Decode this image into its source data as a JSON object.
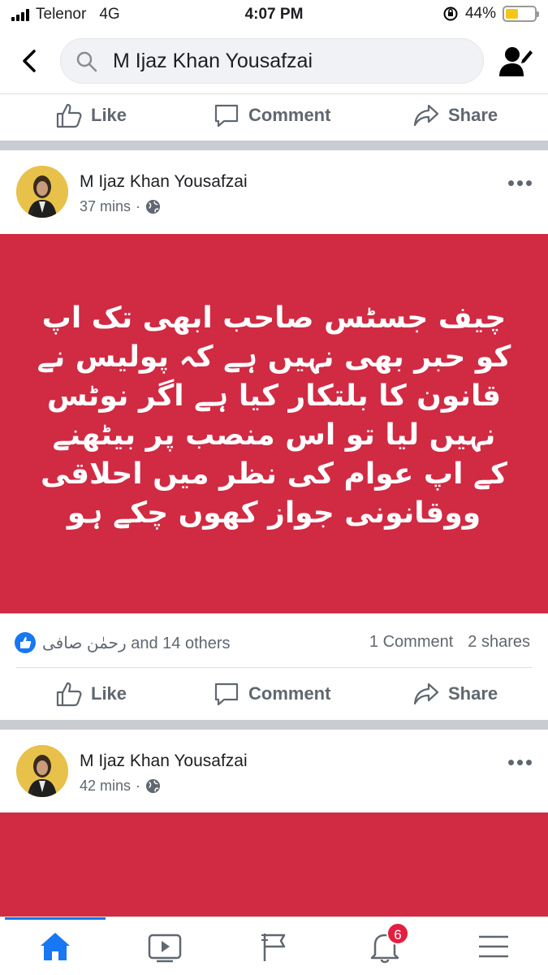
{
  "status_bar": {
    "carrier": "Telenor",
    "network": "4G",
    "time": "4:07 PM",
    "battery": "44%",
    "battery_level": 0.44
  },
  "search": {
    "value": "M Ijaz Khan Yousafzai"
  },
  "actions": {
    "like": "Like",
    "comment": "Comment",
    "share": "Share"
  },
  "posts": [
    {
      "author": "M Ijaz Khan Yousafzai",
      "time": "37 mins",
      "separator": "·",
      "text": "چیف جسٹس صاحب  ابھی تک اپ کو حبر بھی نہیں ہے کہ  پولیس نے قانون کا بلتکار کیا ہے اگر  نوٹس نہیں لیا تو  اس منصب  پر بیٹھنے کے اپ عوام کی نظر میں احلاقی ووقانونی جواز کھوں چکے ہو",
      "reaction_names": "رحمٰن صافی",
      "reaction_others": "and 14 others",
      "comments": "1 Comment",
      "shares": "2 shares"
    },
    {
      "author": "M Ijaz Khan Yousafzai",
      "time": "42 mins",
      "separator": "·"
    }
  ],
  "nav": {
    "notification_count": "6"
  },
  "colors": {
    "post_bg": "#d12a43",
    "accent": "#1877f2",
    "badge": "#e41e3f"
  },
  "icons": [
    "back-arrow-icon",
    "search-icon",
    "profile-edit-icon",
    "thumbs-up-icon",
    "comment-icon",
    "share-icon",
    "globe-icon",
    "more-icon",
    "home-icon",
    "watch-icon",
    "pages-flag-icon",
    "bell-icon",
    "menu-icon"
  ]
}
